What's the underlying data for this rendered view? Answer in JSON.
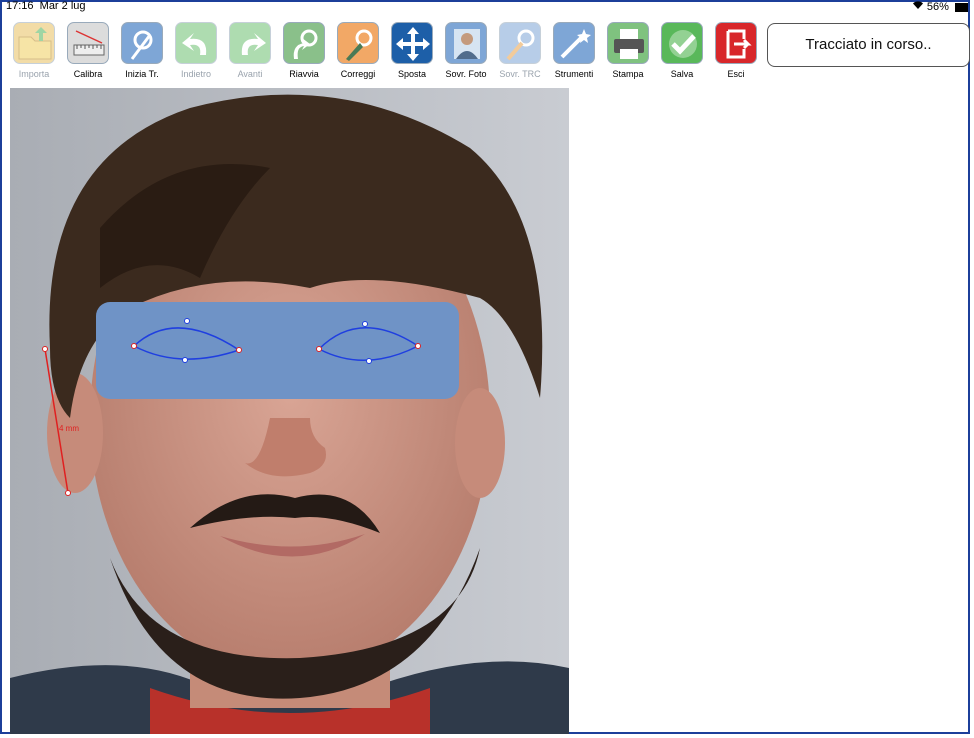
{
  "status_bar": {
    "time": "17:16",
    "date": "Mar 2 lug",
    "battery": "56%"
  },
  "toolbar": [
    {
      "label": "Importa",
      "icon": "folder-import-icon",
      "enabled": false,
      "color": "#e8c061"
    },
    {
      "label": "Calibra",
      "icon": "ruler-calibrate-icon",
      "enabled": true,
      "color": "#dcdcdc"
    },
    {
      "label": "Inizia Tr.",
      "icon": "start-tracing-icon",
      "enabled": true,
      "color": "#7ea6d6"
    },
    {
      "label": "Indietro",
      "icon": "undo-arrow-icon",
      "enabled": false,
      "color": "#6cc070"
    },
    {
      "label": "Avanti",
      "icon": "redo-arrow-icon",
      "enabled": false,
      "color": "#6cc070"
    },
    {
      "label": "Riavvia",
      "icon": "restart-tracing-icon",
      "enabled": true,
      "color": "#8ac08a"
    },
    {
      "label": "Correggi",
      "icon": "correct-tracing-icon",
      "enabled": true,
      "color": "#f2a866"
    },
    {
      "label": "Sposta",
      "icon": "move-arrows-icon",
      "enabled": true,
      "color": "#1d5fa8"
    },
    {
      "label": "Sovr. Foto",
      "icon": "overlay-photo-icon",
      "enabled": true,
      "color": "#7ea6d6"
    },
    {
      "label": "Sovr. TRC",
      "icon": "overlay-trc-icon",
      "enabled": false,
      "color": "#7ea6d6"
    },
    {
      "label": "Strumenti",
      "icon": "tools-wand-icon",
      "enabled": true,
      "color": "#7ea6d6"
    },
    {
      "label": "Stampa",
      "icon": "printer-icon",
      "enabled": true,
      "color": "#7fc27f"
    },
    {
      "label": "Salva",
      "icon": "save-check-icon",
      "enabled": true,
      "color": "#59b85a"
    },
    {
      "label": "Esci",
      "icon": "exit-door-icon",
      "enabled": true,
      "color": "#d8272b"
    }
  ],
  "status_message": "Tracciato in corso..",
  "overlay": {
    "measure_label": "4 mm",
    "eye_mask_color": "#6f93c6",
    "curve_color": "#1f3fe0",
    "point_color": "#e02020"
  }
}
